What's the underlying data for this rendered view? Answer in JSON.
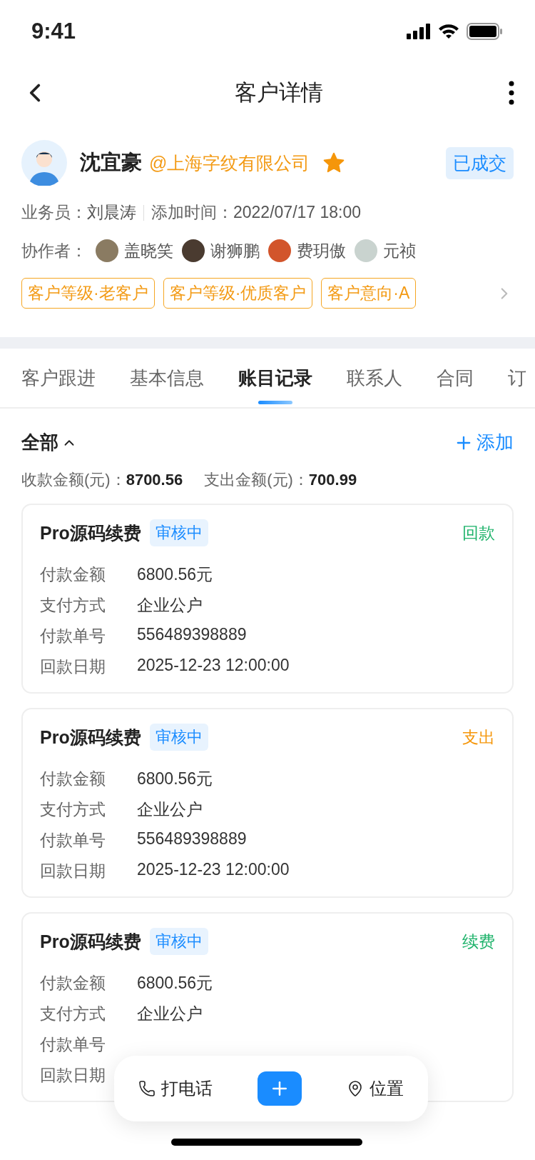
{
  "status_bar": {
    "time": "9:41"
  },
  "nav": {
    "title": "客户详情"
  },
  "customer": {
    "name": "沈宜豪",
    "company": "@上海字纹有限公司",
    "starred": true,
    "status": "已成交",
    "salesperson_label": "业务员：",
    "salesperson": "刘晨涛",
    "added_label": "添加时间：",
    "added": "2022/07/17 18:00",
    "collaborators_label": "协作者：",
    "collaborators": [
      {
        "name": "盖晓笑"
      },
      {
        "name": "谢狮鹏"
      },
      {
        "name": "费玥傲"
      },
      {
        "name": "元祯"
      }
    ],
    "tags": [
      "客户等级·老客户",
      "客户等级·优质客户",
      "客户意向·A"
    ]
  },
  "tabs": [
    {
      "label": "客户跟进",
      "selected": false
    },
    {
      "label": "基本信息",
      "selected": false
    },
    {
      "label": "账目记录",
      "selected": true
    },
    {
      "label": "联系人",
      "selected": false
    },
    {
      "label": "合同",
      "selected": false
    },
    {
      "label": "订",
      "selected": false
    }
  ],
  "filter": {
    "label": "全部",
    "add": "添加"
  },
  "summary": [
    {
      "label": "收款金额(元)：",
      "value": "8700.56"
    },
    {
      "label": "支出金额(元)：",
      "value": "700.99"
    }
  ],
  "records": [
    {
      "title": "Pro源码续费",
      "status": "审核中",
      "type": "回款",
      "color": "#1fb36b",
      "fields": [
        {
          "label": "付款金额",
          "value": "6800.56元"
        },
        {
          "label": "支付方式",
          "value": "企业公户"
        },
        {
          "label": "付款单号",
          "value": "556489398889"
        },
        {
          "label": "回款日期",
          "value": "2025-12-23 12:00:00"
        }
      ]
    },
    {
      "title": "Pro源码续费",
      "status": "审核中",
      "type": "支出",
      "color": "#f5960a",
      "fields": [
        {
          "label": "付款金额",
          "value": "6800.56元"
        },
        {
          "label": "支付方式",
          "value": "企业公户"
        },
        {
          "label": "付款单号",
          "value": "556489398889"
        },
        {
          "label": "回款日期",
          "value": "2025-12-23 12:00:00"
        }
      ]
    },
    {
      "title": "Pro源码续费",
      "status": "审核中",
      "type": "续费",
      "color": "#1fb36b",
      "fields": [
        {
          "label": "付款金额",
          "value": "6800.56元"
        },
        {
          "label": "支付方式",
          "value": "企业公户"
        },
        {
          "label": "付款单号"
        },
        {
          "label": "回款日期"
        }
      ]
    }
  ],
  "action_bar": {
    "call": "打电话",
    "location": "位置"
  }
}
